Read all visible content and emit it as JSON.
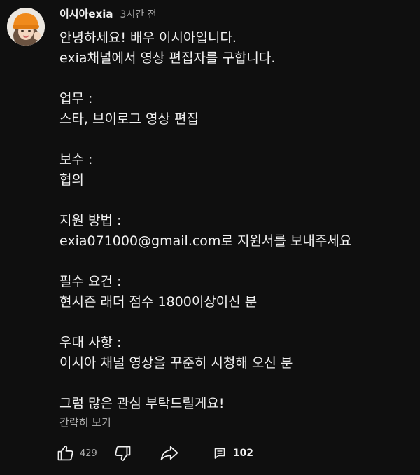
{
  "comment": {
    "author": "이시아exia",
    "time": "3시간 전",
    "lines": [
      "안녕하세요! 배우 이시아입니다.",
      "exia채널에서 영상 편집자를 구합니다.",
      "",
      "업무 :",
      "스타, 브이로그 영상 편집",
      "",
      "보수 :",
      "협의",
      "",
      "지원 방법 :",
      "exia071000@gmail.com로 지원서를 보내주세요",
      "",
      "필수 요건 :",
      "현시즌 래더 점수 1800이상이신 분",
      "",
      "우대 사항 :",
      "이시아 채널 영상을 꾸준히 시청해 오신 분",
      "",
      "그럼 많은 관심 부탁드릴게요!"
    ],
    "read_less": "간략히 보기"
  },
  "actions": {
    "like_count": "429",
    "reply_count": "102",
    "icons": [
      "thumbs-up-icon",
      "thumbs-down-icon",
      "share-icon",
      "reply-icon"
    ]
  },
  "colors": {
    "background": "#0f0f0f",
    "text_primary": "#f1f1f1",
    "text_secondary": "#aaaaaa",
    "avatar_beanie": "#f08a1c"
  }
}
